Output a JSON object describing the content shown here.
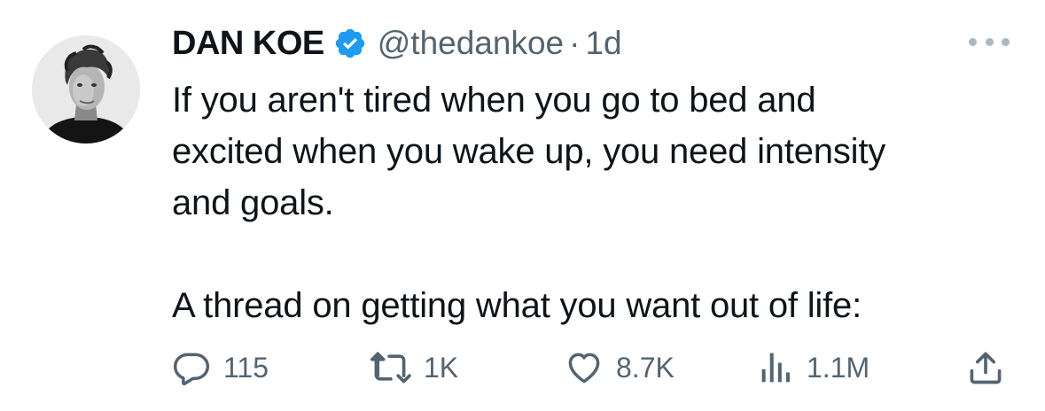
{
  "author": {
    "name": "DAN KOE",
    "handle": "@thedankoe",
    "separator": "·",
    "time": "1d",
    "verified": true
  },
  "tweet": {
    "text": "If you aren't tired when you go to bed and\nexcited when you wake up, you need intensity\nand goals.\n\nA thread on getting what you want out of life:"
  },
  "actions": {
    "replies": "115",
    "retweets": "1K",
    "likes": "8.7K",
    "views": "1.1M"
  },
  "colors": {
    "verified_badge": "#1d9bf0",
    "secondary_text": "#536471",
    "primary_text": "#0f1419"
  },
  "icons": {
    "verified": "verified-badge-icon",
    "more": "more-dots-icon",
    "reply": "reply-icon",
    "retweet": "retweet-icon",
    "like": "heart-icon",
    "views": "views-chart-icon",
    "share": "share-icon"
  }
}
